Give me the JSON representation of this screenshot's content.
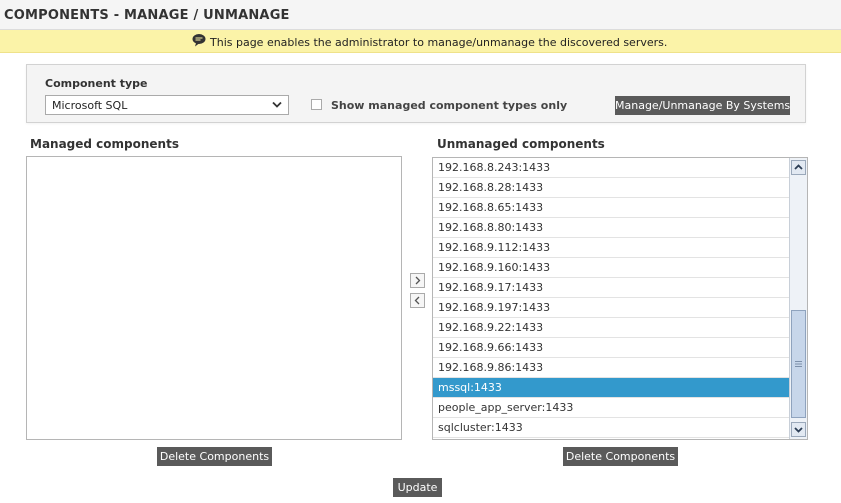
{
  "header": {
    "title": "COMPONENTS - MANAGE / UNMANAGE"
  },
  "notice": {
    "icon": "speech-bubble-icon",
    "text": "This page enables the administrator to manage/unmanage the discovered servers."
  },
  "filter": {
    "component_type_label": "Component type",
    "selected_type": "Microsoft SQL",
    "show_managed_only_label": "Show managed component types only",
    "show_managed_only_checked": false,
    "systems_button_label": "Manage/Unmanage By Systems"
  },
  "managed": {
    "label": "Managed components",
    "items": [],
    "delete_label": "Delete Components"
  },
  "unmanaged": {
    "label": "Unmanaged components",
    "items": [
      "192.168.8.243:1433",
      "192.168.8.28:1433",
      "192.168.8.65:1433",
      "192.168.8.80:1433",
      "192.168.9.112:1433",
      "192.168.9.160:1433",
      "192.168.9.17:1433",
      "192.168.9.197:1433",
      "192.168.9.22:1433",
      "192.168.9.66:1433",
      "192.168.9.86:1433",
      "mssql:1433",
      "people_app_server:1433",
      "sqlcluster:1433"
    ],
    "selected_item": "mssql:1433",
    "delete_label": "Delete Components"
  },
  "actions": {
    "update_label": "Update"
  },
  "colors": {
    "notice_bg": "#fbf3a8",
    "selected_row": "#3399cc",
    "button_bg": "#5a5a5a"
  }
}
